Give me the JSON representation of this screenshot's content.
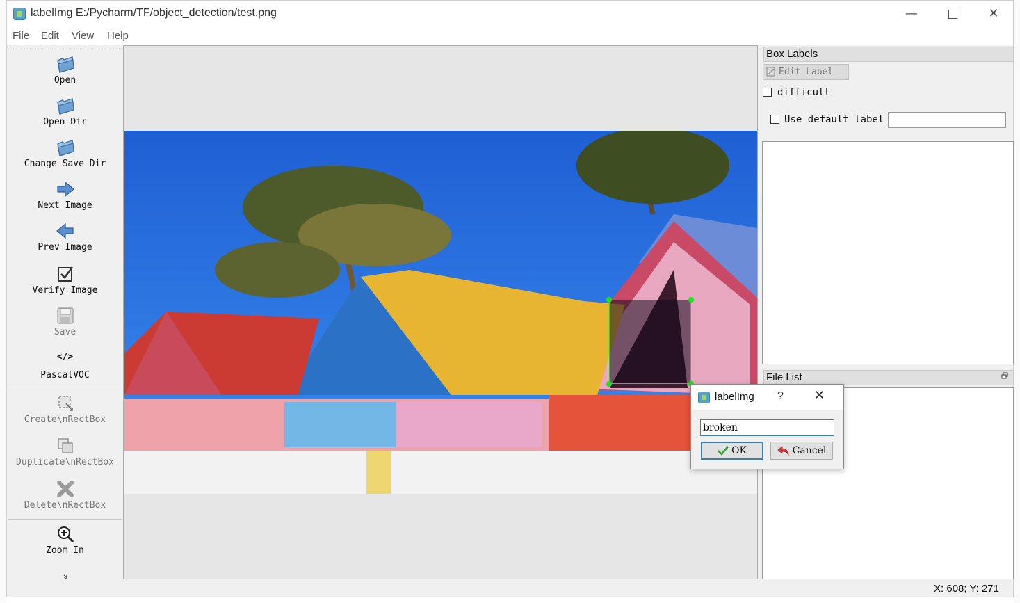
{
  "window": {
    "app_name": "labelImg",
    "title": "labelImg E:/Pycharm/TF/object_detection/test.png"
  },
  "menu": [
    "File",
    "Edit",
    "View",
    "Help"
  ],
  "toolbar": {
    "open": "Open",
    "open_dir": "Open Dir",
    "change_save_dir": "Change Save Dir",
    "next_image": "Next Image",
    "prev_image": "Prev Image",
    "verify_image": "Verify Image",
    "save": "Save",
    "format_icon_text": "</>",
    "format": "PascalVOC",
    "create_rect": "Create\\nRectBox",
    "duplicate_rect": "Duplicate\\nRectBox",
    "delete_rect": "Delete\\nRectBox",
    "zoom_in": "Zoom In",
    "more": "»"
  },
  "box_labels": {
    "title": "Box Labels",
    "edit_label": "Edit Label",
    "difficult": "difficult",
    "use_default_label": "Use default label",
    "default_label_value": ""
  },
  "file_list": {
    "title": "File List"
  },
  "dialog": {
    "title": "labelImg",
    "help": "?",
    "input_value": "broken",
    "ok": "OK",
    "cancel": "Cancel"
  },
  "status": {
    "text": "X: 608; Y: 271"
  }
}
